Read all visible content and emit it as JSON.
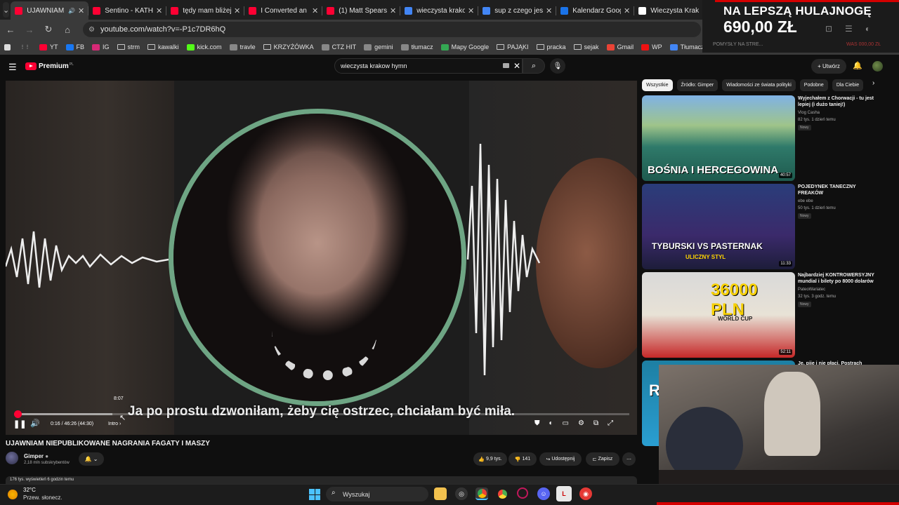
{
  "browser": {
    "tabs": [
      {
        "label": "UJAWNIAM N",
        "active": true,
        "favicon": "youtube-icon",
        "color": "#ff0033",
        "audio": true
      },
      {
        "label": "Sentino - KATHAF",
        "favicon": "youtube-icon",
        "color": "#ff0033"
      },
      {
        "label": "tędy mam bliżej -",
        "favicon": "youtube-icon",
        "color": "#ff0033"
      },
      {
        "label": "I Converted an Et",
        "favicon": "youtube-icon",
        "color": "#ff0033"
      },
      {
        "label": "(1) Matt Spears -",
        "favicon": "youtube-icon",
        "color": "#ff0033"
      },
      {
        "label": "wieczysta krakow",
        "favicon": "google-icon",
        "color": "#4285f4"
      },
      {
        "label": "sup z czego jest z",
        "favicon": "google-icon",
        "color": "#4285f4"
      },
      {
        "label": "Kalendarz Google",
        "favicon": "calendar-icon",
        "color": "#1a73e8"
      },
      {
        "label": "Wieczysta Krakó",
        "favicon": "wikipedia-icon",
        "color": "#ffffff"
      }
    ],
    "url": "youtube.com/watch?v=-P1c7DR6hQ",
    "bookmarks": [
      {
        "label": "",
        "icon": "apps-icon"
      },
      {
        "label": "YT",
        "icon": "youtube-icon",
        "color": "#ff0033"
      },
      {
        "label": "FB",
        "icon": "facebook-icon",
        "color": "#1877f2"
      },
      {
        "label": "IG",
        "icon": "instagram-icon",
        "color": "#d62976"
      },
      {
        "label": "strm",
        "icon": "folder-icon"
      },
      {
        "label": "kawalki",
        "icon": "folder-icon"
      },
      {
        "label": "kick.com",
        "icon": "kick-icon",
        "color": "#53fc18"
      },
      {
        "label": "travle",
        "icon": "globe-icon"
      },
      {
        "label": "KRZYŻÓWKA",
        "icon": "folder-icon"
      },
      {
        "label": "CTZ HIT",
        "icon": "ctz-icon"
      },
      {
        "label": "gemini",
        "icon": "gemini-icon"
      },
      {
        "label": "tłumacz",
        "icon": "translate-icon"
      },
      {
        "label": "Mapy Google",
        "icon": "maps-icon",
        "color": "#34a853"
      },
      {
        "label": "PAJĄKI",
        "icon": "folder-icon"
      },
      {
        "label": "pracka",
        "icon": "folder-icon"
      },
      {
        "label": "sejak",
        "icon": "folder-icon"
      },
      {
        "label": "Gmail",
        "icon": "gmail-icon",
        "color": "#ea4335"
      },
      {
        "label": "WP",
        "icon": "wp-icon",
        "color": "#e11"
      },
      {
        "label": "Tłumacz",
        "icon": "translate-icon",
        "color": "#4285f4"
      },
      {
        "label": "ksiazka",
        "icon": "book-icon",
        "color": "#2e7d32"
      }
    ]
  },
  "ad": {
    "line1": "NA LEPSZĄ HULAJNOGĘ",
    "line2": "690,00 ZŁ",
    "under": "POMYSŁY NA STRE...",
    "under2": "WAS 000,00 ZŁ"
  },
  "youtube": {
    "logo": "Premium",
    "logo_sup": "PL",
    "search_value": "wieczysta krakow hymn",
    "create_label": "Utwórz"
  },
  "player": {
    "caption": "Ja po prostu dzwoniłam, żeby cię ostrzec, chciałam być miła.",
    "hover_time": "8:07",
    "time": "0:16 / 46:26 (44:30)",
    "chapter": "Intro",
    "progress_played": 0.006,
    "progress_loaded": 0.16
  },
  "video": {
    "title": "UJAWNIAM NIEPUBLIKOWANE NAGRANIA FAGATY I MASZY",
    "channel": "Gimper",
    "subs": "2,18 mln subskrybentów",
    "likes": "9,9 tys.",
    "dislikes": "141",
    "share": "Udostępnij",
    "save": "Zapisz",
    "views": "176 tys. wyświetleń  6 godzin temu"
  },
  "sidebar": {
    "chips": [
      "Wszystkie",
      "Źródło: Gimper",
      "Wiadomości ze świata polityki",
      "Podobne",
      "Dla Ciebie"
    ],
    "recs": [
      {
        "thumb_text": "BOŚNIA I HERCEGOWINA",
        "duration": "40:57",
        "title": "Wyjechałem z Chorwacji - tu jest lepiej (i dużo taniej!)",
        "channel": "Vlog Casha",
        "meta": "82 tys.  1 dzień temu",
        "badge": "Nowy"
      },
      {
        "thumb_text": "TYBURSKI VS PASTERNAK",
        "thumb_sub": "ULICZNY STYL",
        "duration": "11:33",
        "title": "POJEDYNEK TANECZNY FREAKÓW",
        "channel": "ebe ebe",
        "meta": "50 tys.  1 dzień temu",
        "badge": "Nowy"
      },
      {
        "thumb_text": "36000 PLN",
        "thumb_sub": "WORLD CUP",
        "duration": "52:11",
        "title": "Najbardziej KONTROWERSYJNY mundial i bilety po 8000 dolarów",
        "channel": "PateoWariatec",
        "meta": "32 tys.  3 godz. temu",
        "badge": "Nowy"
      },
      {
        "thumb_text": "R",
        "title": "Je, pije i nie płaci. Postrach śląskich"
      }
    ]
  },
  "taskbar": {
    "temp": "32°C",
    "weather": "Przew. słonecz.",
    "search": "Wyszukaj"
  }
}
